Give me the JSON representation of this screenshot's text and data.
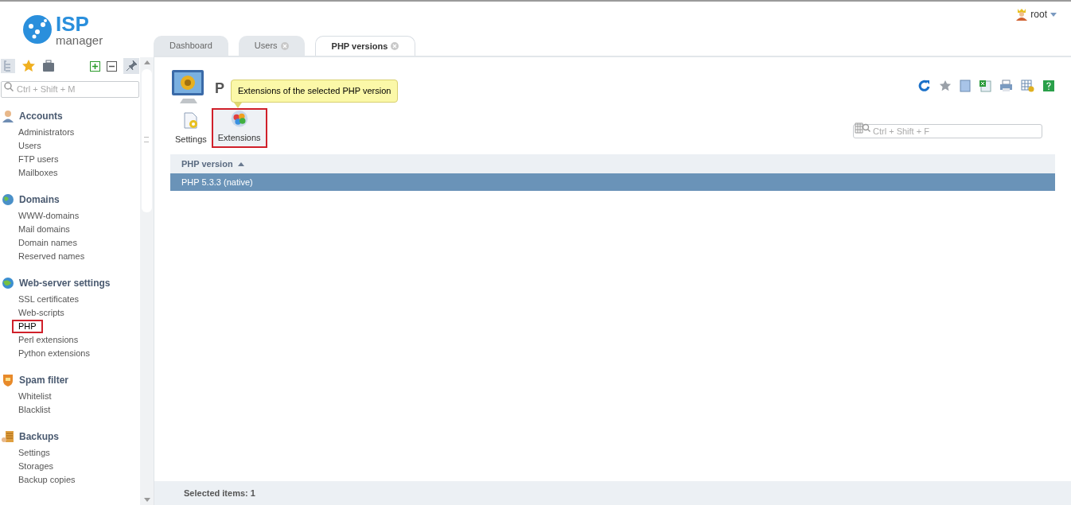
{
  "logo": {
    "line1": "ISP",
    "line2": "manager"
  },
  "user": {
    "name": "root"
  },
  "tabs": [
    {
      "label": "Dashboard",
      "selected": false,
      "closable": false
    },
    {
      "label": "Users",
      "selected": false,
      "closable": true
    },
    {
      "label": "PHP versions",
      "selected": true,
      "closable": true
    }
  ],
  "sidebar": {
    "search_placeholder": "Ctrl + Shift + M",
    "groups": [
      {
        "kind": "accounts",
        "title": "Accounts",
        "items": [
          {
            "label": "Administrators",
            "highlighted": false
          },
          {
            "label": "Users",
            "highlighted": false
          },
          {
            "label": "FTP users",
            "highlighted": false
          },
          {
            "label": "Mailboxes",
            "highlighted": false
          }
        ]
      },
      {
        "kind": "domains",
        "title": "Domains",
        "items": [
          {
            "label": "WWW-domains",
            "highlighted": false
          },
          {
            "label": "Mail domains",
            "highlighted": false
          },
          {
            "label": "Domain names",
            "highlighted": false
          },
          {
            "label": "Reserved names",
            "highlighted": false
          }
        ]
      },
      {
        "kind": "web",
        "title": "Web-server settings",
        "items": [
          {
            "label": "SSL certificates",
            "highlighted": false
          },
          {
            "label": "Web-scripts",
            "highlighted": false
          },
          {
            "label": "PHP",
            "highlighted": true
          },
          {
            "label": "Perl extensions",
            "highlighted": false
          },
          {
            "label": "Python extensions",
            "highlighted": false
          }
        ]
      },
      {
        "kind": "spam",
        "title": "Spam filter",
        "items": [
          {
            "label": "Whitelist",
            "highlighted": false
          },
          {
            "label": "Blacklist",
            "highlighted": false
          }
        ]
      },
      {
        "kind": "backups",
        "title": "Backups",
        "items": [
          {
            "label": "Settings",
            "highlighted": false
          },
          {
            "label": "Storages",
            "highlighted": false
          },
          {
            "label": "Backup copies",
            "highlighted": false
          }
        ]
      }
    ]
  },
  "page": {
    "title": "P",
    "tooltip": "Extensions of the selected PHP version",
    "toolbar": [
      {
        "kind": "settings",
        "label": "Settings",
        "highlighted": false
      },
      {
        "kind": "extensions",
        "label": "Extensions",
        "highlighted": true
      }
    ],
    "filter_placeholder": "Ctrl + Shift + F",
    "table": {
      "columns": [
        "PHP version"
      ],
      "rows": [
        {
          "cells": [
            "PHP 5.3.3 (native)"
          ],
          "selected": true
        }
      ]
    },
    "status": "Selected items: 1"
  }
}
